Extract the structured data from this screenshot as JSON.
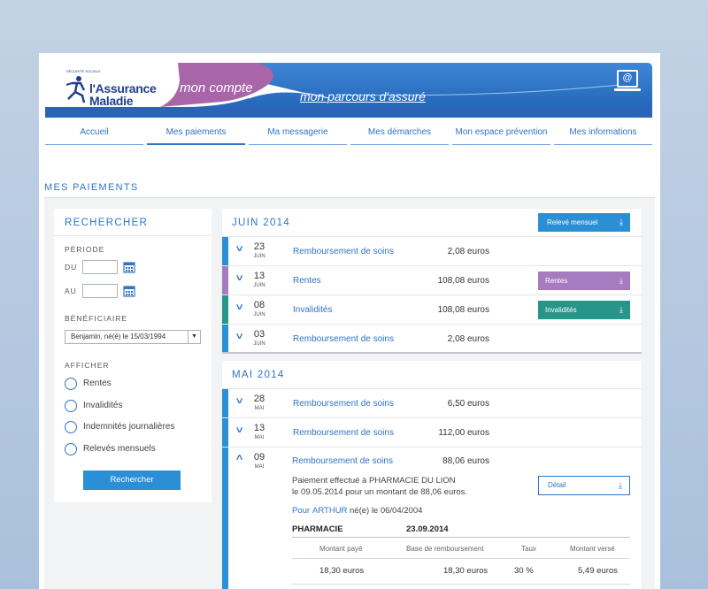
{
  "header": {
    "logo_line1": "l'Assurance",
    "logo_line2": "Maladie",
    "logo_tagline": "SÉCURITÉ SOCIALE",
    "mon_compte": "mon compte",
    "parcours": "mon parcours d'assuré",
    "mail_icon": "@"
  },
  "nav": {
    "items": [
      {
        "label": "Accueil"
      },
      {
        "label": "Mes paiements"
      },
      {
        "label": "Ma messagerie"
      },
      {
        "label": "Mes démarches"
      },
      {
        "label": "Mon espace prévention"
      },
      {
        "label": "Mes informations"
      }
    ],
    "active_index": 1
  },
  "page": {
    "title": "MES PAIEMENTS"
  },
  "search": {
    "title": "RECHERCHER",
    "periode_label": "PÉRIODE",
    "du_label": "DU",
    "au_label": "AU",
    "du_value": "",
    "au_value": "",
    "beneficiaire_label": "BÉNÉFICIAIRE",
    "beneficiaire_value": "Benjamin, né(é) le 15/03/1994",
    "afficher_label": "AFFICHER",
    "options": [
      {
        "label": "Rentes"
      },
      {
        "label": "Invalidités"
      },
      {
        "label": "Indemnités journalières"
      },
      {
        "label": "Relevés mensuels"
      }
    ],
    "button_label": "Rechercher"
  },
  "juin": {
    "title": "JUIN 2014",
    "releve_label": "Relevé mensuel",
    "rows": [
      {
        "day": "23",
        "month": "JUIN",
        "label": "Remboursement de soins",
        "amount": "2,08 euros",
        "tag": ""
      },
      {
        "day": "13",
        "month": "JUIN",
        "label": "Rentes",
        "amount": "108,08 euros",
        "tag": "Rentes"
      },
      {
        "day": "08",
        "month": "JUIN",
        "label": "Invalidités",
        "amount": "108,08 euros",
        "tag": "Invalidités"
      },
      {
        "day": "03",
        "month": "JUIN",
        "label": "Remboursement de soins",
        "amount": "2,08 euros",
        "tag": ""
      }
    ]
  },
  "mai": {
    "title": "MAI 2014",
    "rows": [
      {
        "day": "28",
        "month": "MAI",
        "label": "Remboursement de soins",
        "amount": "6,50 euros"
      },
      {
        "day": "13",
        "month": "MAI",
        "label": "Remboursement de soins",
        "amount": "112,00 euros"
      }
    ],
    "expanded": {
      "day": "09",
      "month": "MAI",
      "label": "Remboursement de soins",
      "amount": "88,06 euros",
      "desc_line1": "Paiement effectué à PHARMACIE DU LION",
      "desc_line2": "le 09.05.2014 pour un montant de 88,06 euros.",
      "detail_label": "Détail",
      "pour_label": "Pour",
      "pour_name": "ARTHUR",
      "pour_birth": "né(e) le 06/04/2004",
      "section_label": "PHARMACIE",
      "section_date": "23.09.2014",
      "table_headers": [
        "Montant payé",
        "Base de remboursement",
        "Taux",
        "Montant versé"
      ],
      "table_values": [
        "18,30 euros",
        "18,30 euros",
        "30 %",
        "5,49 euros"
      ]
    }
  },
  "colors": {
    "blue": "#2f74c7",
    "button_blue": "#2b8fd6",
    "rentes": "#a57cc0",
    "invalidites": "#27958a"
  }
}
